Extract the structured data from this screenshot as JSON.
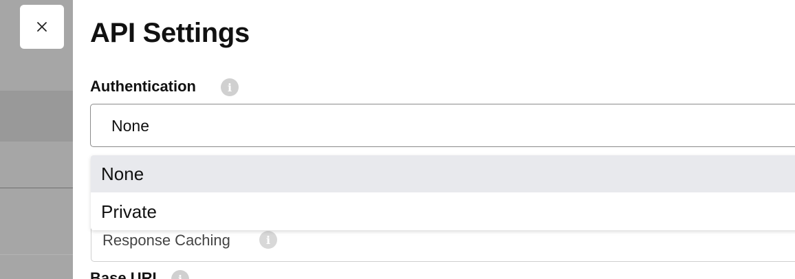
{
  "page": {
    "title": "API Settings"
  },
  "authentication": {
    "label": "Authentication",
    "selected": "None",
    "options": [
      "None",
      "Private"
    ]
  },
  "response_caching": {
    "label": "Response Caching"
  },
  "base_url": {
    "label": "Base URL"
  },
  "colors": {
    "highlight": "#e8e9ed",
    "overlay": "#a6a6a6"
  },
  "icons": {
    "close": "close-icon",
    "info": "info-icon"
  }
}
